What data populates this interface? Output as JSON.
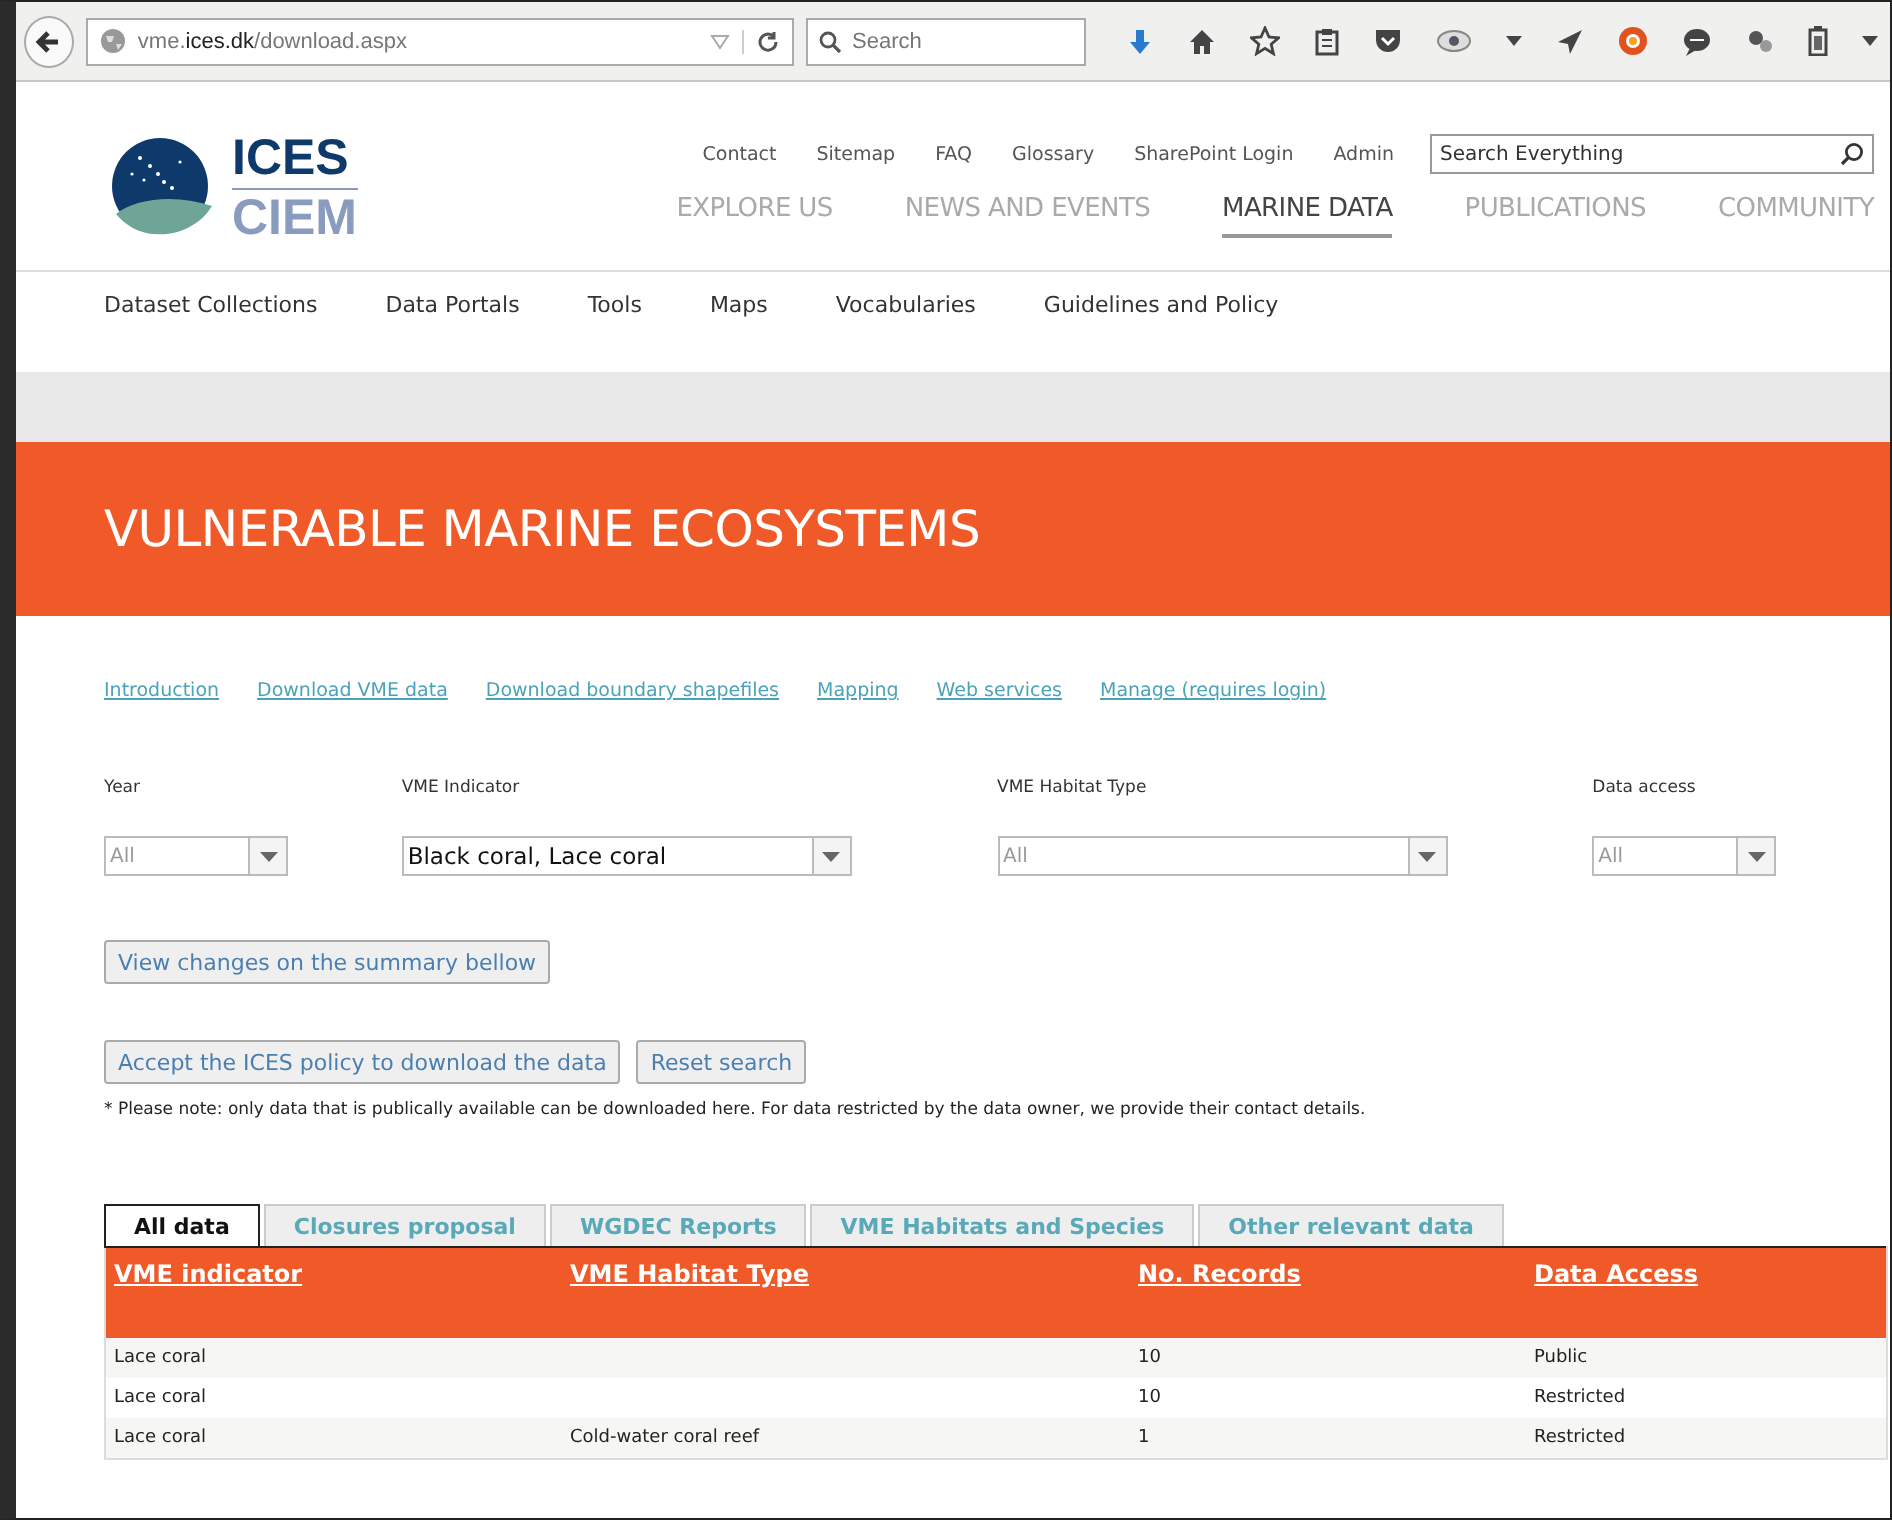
{
  "browser": {
    "url_prefix": "vme.",
    "url_domain": "ices.dk",
    "url_path": "/download.aspx",
    "search_placeholder": "Search"
  },
  "logo": {
    "line1": "ICES",
    "line2": "CIEM"
  },
  "top_links": [
    "Contact",
    "Sitemap",
    "FAQ",
    "Glossary",
    "SharePoint Login",
    "Admin"
  ],
  "site_search": {
    "placeholder": "Search Everything"
  },
  "main_nav": [
    {
      "label": "EXPLORE US",
      "selected": false
    },
    {
      "label": "NEWS AND EVENTS",
      "selected": false
    },
    {
      "label": "MARINE DATA",
      "selected": true
    },
    {
      "label": "PUBLICATIONS",
      "selected": false
    },
    {
      "label": "COMMUNITY",
      "selected": false
    }
  ],
  "sub_nav": [
    "Dataset Collections",
    "Data Portals",
    "Tools",
    "Maps",
    "Vocabularies",
    "Guidelines and Policy"
  ],
  "banner": {
    "title": "VULNERABLE MARINE ECOSYSTEMS"
  },
  "page_links": [
    "Introduction",
    "Download VME data",
    "Download boundary shapefiles",
    "Mapping",
    "Web services",
    "Manage (requires login)"
  ],
  "filters": [
    {
      "label": "Year",
      "value": "All"
    },
    {
      "label": "VME Indicator",
      "value": "Black coral, Lace coral"
    },
    {
      "label": "VME Habitat Type",
      "value": "All"
    },
    {
      "label": "Data access",
      "value": "All"
    }
  ],
  "view_button": "View changes on the summary bellow",
  "action_buttons": [
    "Accept the ICES policy to download the data",
    "Reset search"
  ],
  "note": "* Please note: only data that is publically available can be downloaded here. For data restricted by the data owner, we provide their contact details.",
  "tabs": [
    {
      "label": "All data",
      "selected": true
    },
    {
      "label": "Closures proposal",
      "selected": false
    },
    {
      "label": "WGDEC Reports",
      "selected": false
    },
    {
      "label": "VME Habitats and Species",
      "selected": false
    },
    {
      "label": "Other relevant data",
      "selected": false
    }
  ],
  "table": {
    "columns": [
      "VME indicator",
      "VME Habitat Type",
      "No. Records",
      "Data Access"
    ],
    "rows": [
      [
        "Lace coral",
        "",
        "10",
        "Public"
      ],
      [
        "Lace coral",
        "",
        "10",
        "Restricted"
      ],
      [
        "Lace coral",
        "Cold-water coral reef",
        "1",
        "Restricted"
      ]
    ]
  }
}
